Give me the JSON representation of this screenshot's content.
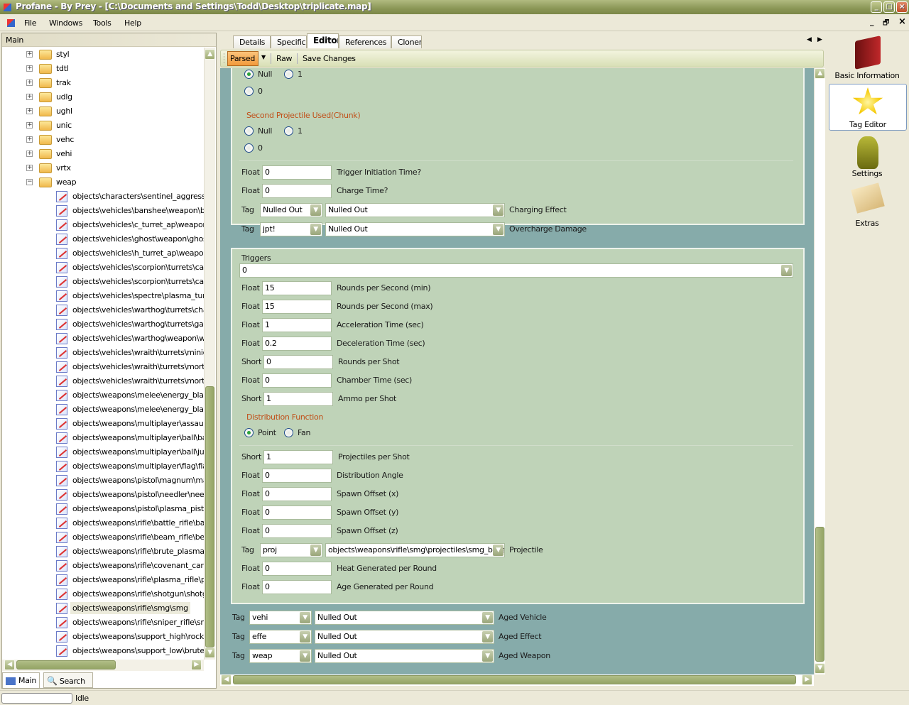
{
  "window": {
    "title": "Profane - By Prey - [C:\\Documents and Settings\\Todd\\Desktop\\triplicate.map]",
    "min": "_",
    "max": "□",
    "close": "×"
  },
  "menu": {
    "items": [
      "File",
      "Windows",
      "Tools",
      "Help"
    ],
    "mdi_min": "_",
    "mdi_restore": "🗗",
    "mdi_close": "×"
  },
  "left": {
    "header": "Main",
    "folders": [
      {
        "name": "styl",
        "expanded": false
      },
      {
        "name": "tdtl",
        "expanded": false
      },
      {
        "name": "trak",
        "expanded": false
      },
      {
        "name": "udlg",
        "expanded": false
      },
      {
        "name": "ughl",
        "expanded": false
      },
      {
        "name": "unic",
        "expanded": false
      },
      {
        "name": "vehc",
        "expanded": false
      },
      {
        "name": "vehi",
        "expanded": false
      },
      {
        "name": "vrtx",
        "expanded": false
      },
      {
        "name": "weap",
        "expanded": true
      }
    ],
    "items": [
      "objects\\characters\\sentinel_aggressor\\",
      "objects\\vehicles\\banshee\\weapon\\banshee",
      "objects\\vehicles\\c_turret_ap\\weapon\\",
      "objects\\vehicles\\ghost\\weapon\\ghost_",
      "objects\\vehicles\\h_turret_ap\\weapon\\",
      "objects\\vehicles\\scorpion\\turrets\\cannon",
      "objects\\vehicles\\scorpion\\turrets\\cannon",
      "objects\\vehicles\\spectre\\plasma_turret",
      "objects\\vehicles\\warthog\\turrets\\chain",
      "objects\\vehicles\\warthog\\turrets\\gauss",
      "objects\\vehicles\\warthog\\weapon\\warthog",
      "objects\\vehicles\\wraith\\turrets\\minigun",
      "objects\\vehicles\\wraith\\turrets\\mortar\\",
      "objects\\vehicles\\wraith\\turrets\\mortar\\",
      "objects\\weapons\\melee\\energy_blade",
      "objects\\weapons\\melee\\energy_blade",
      "objects\\weapons\\multiplayer\\assault_b",
      "objects\\weapons\\multiplayer\\ball\\ball",
      "objects\\weapons\\multiplayer\\ball\\jugg",
      "objects\\weapons\\multiplayer\\flag\\flag",
      "objects\\weapons\\pistol\\magnum\\magnum",
      "objects\\weapons\\pistol\\needler\\needler",
      "objects\\weapons\\pistol\\plasma_pistol\\",
      "objects\\weapons\\rifle\\battle_rifle\\battle",
      "objects\\weapons\\rifle\\beam_rifle\\beam",
      "objects\\weapons\\rifle\\brute_plasma_rifle",
      "objects\\weapons\\rifle\\covenant_carbine",
      "objects\\weapons\\rifle\\plasma_rifle\\plasma",
      "objects\\weapons\\rifle\\shotgun\\shotgun",
      "objects\\weapons\\rifle\\smg\\smg",
      "objects\\weapons\\rifle\\sniper_rifle\\sniper",
      "objects\\weapons\\support_high\\rocket_",
      "objects\\weapons\\support_low\\brute_s"
    ],
    "selected_item": "objects\\weapons\\rifle\\smg\\smg",
    "tabs": [
      "Main",
      "Search"
    ]
  },
  "center": {
    "tabs": [
      "Details",
      "Specific",
      "Editor",
      "References",
      "Cloner"
    ],
    "active_tab": "Editor",
    "toolbar": {
      "parsed": "Parsed",
      "raw": "Raw",
      "save": "Save Changes"
    },
    "panel1": [
      {
        "kind": "radio",
        "options": [
          "Null",
          "1"
        ],
        "selected": "Null"
      },
      {
        "kind": "radio",
        "options": [
          "0"
        ],
        "selected": ""
      },
      {
        "kind": "section",
        "label": "Second Projectile Used(Chunk)"
      },
      {
        "kind": "radio",
        "options": [
          "Null",
          "1"
        ],
        "selected": ""
      },
      {
        "kind": "radio",
        "options": [
          "0"
        ],
        "selected": ""
      },
      {
        "kind": "sep"
      },
      {
        "kind": "field",
        "type": "Float",
        "value": "0",
        "label": "Trigger Initiation Time?"
      },
      {
        "kind": "field",
        "type": "Float",
        "value": "0",
        "label": "Charge Time?"
      },
      {
        "kind": "tag",
        "type": "Tag",
        "tag": "Nulled Out",
        "value": "Nulled Out",
        "label": "Charging Effect"
      },
      {
        "kind": "tag",
        "type": "Tag",
        "tag": "jpt!",
        "value": "Nulled Out",
        "label": "Overcharge Damage"
      }
    ],
    "panel2": {
      "title": "Triggers",
      "selector": "0",
      "rows": [
        {
          "kind": "field",
          "type": "Float",
          "value": "15",
          "label": "Rounds per Second (min)"
        },
        {
          "kind": "field",
          "type": "Float",
          "value": "15",
          "label": "Rounds per Second (max)"
        },
        {
          "kind": "field",
          "type": "Float",
          "value": "1",
          "label": "Acceleration Time (sec)"
        },
        {
          "kind": "field",
          "type": "Float",
          "value": "0.2",
          "label": "Deceleration Time (sec)"
        },
        {
          "kind": "field",
          "type": "Short",
          "value": "0",
          "label": "Rounds per Shot"
        },
        {
          "kind": "field",
          "type": "Float",
          "value": "0",
          "label": "Chamber Time (sec)"
        },
        {
          "kind": "field",
          "type": "Short",
          "value": "1",
          "label": "Ammo per Shot"
        },
        {
          "kind": "section",
          "label": "Distribution Function"
        },
        {
          "kind": "radio",
          "options": [
            "Point",
            "Fan"
          ],
          "selected": "Point"
        },
        {
          "kind": "sep"
        },
        {
          "kind": "field",
          "type": "Short",
          "value": "1",
          "label": "Projectiles per Shot"
        },
        {
          "kind": "field",
          "type": "Float",
          "value": "0",
          "label": "Distribution Angle"
        },
        {
          "kind": "field",
          "type": "Float",
          "value": "0",
          "label": "Spawn Offset (x)"
        },
        {
          "kind": "field",
          "type": "Float",
          "value": "0",
          "label": "Spawn Offset (y)"
        },
        {
          "kind": "field",
          "type": "Float",
          "value": "0",
          "label": "Spawn Offset (z)"
        },
        {
          "kind": "tag",
          "type": "Tag",
          "tag": "proj",
          "value": "objects\\weapons\\rifle\\smg\\projectiles\\smg_bullet",
          "label": "Projectile"
        },
        {
          "kind": "field",
          "type": "Float",
          "value": "0",
          "label": "Heat Generated per Round"
        },
        {
          "kind": "field",
          "type": "Float",
          "value": "0",
          "label": "Age Generated per Round"
        }
      ]
    },
    "outer_rows": [
      {
        "type": "Tag",
        "tag": "vehi",
        "value": "Nulled Out",
        "label": "Aged Vehicle"
      },
      {
        "type": "Tag",
        "tag": "effe",
        "value": "Nulled Out",
        "label": "Aged Effect"
      },
      {
        "type": "Tag",
        "tag": "weap",
        "value": "Nulled Out",
        "label": "Aged Weapon"
      }
    ]
  },
  "right": {
    "items": [
      {
        "label": "Basic Information",
        "icon": "book-icon"
      },
      {
        "label": "Tag Editor",
        "icon": "star-icon",
        "active": true
      },
      {
        "label": "Settings",
        "icon": "robot-icon"
      },
      {
        "label": "Extras",
        "icon": "envelope-icon"
      }
    ]
  },
  "status": {
    "text": "Idle"
  },
  "colors": {
    "title": "#8a9656",
    "editor_bg": "#86abaa",
    "panel_bg": "#bfd3b8",
    "section": "#c0501a",
    "parsed_button": "#f5a54a"
  }
}
